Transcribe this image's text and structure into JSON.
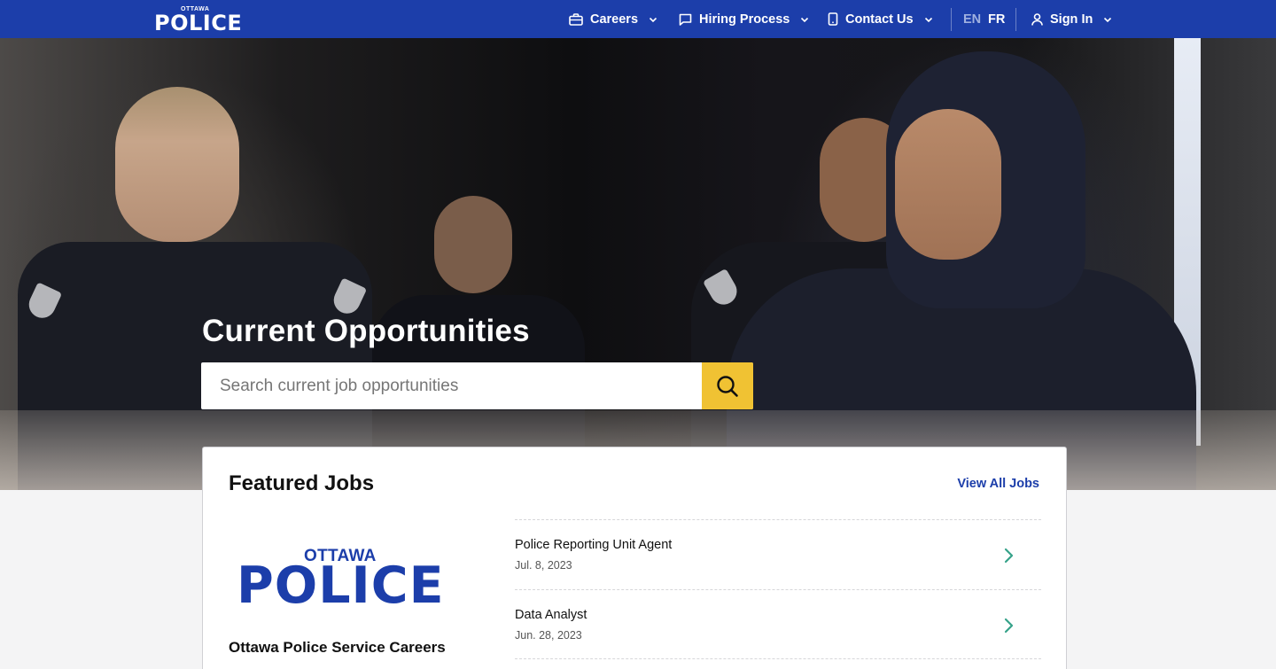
{
  "nav": {
    "logo_small": "OTTAWA",
    "logo_big": "POLICE",
    "items": [
      {
        "label": "Careers",
        "icon": "briefcase-icon"
      },
      {
        "label": "Hiring Process",
        "icon": "chat-bubble-icon"
      },
      {
        "label": "Contact Us",
        "icon": "phone-icon"
      }
    ],
    "lang_en": "EN",
    "lang_fr": "FR",
    "sign_in": "Sign In",
    "colors": {
      "nav_bg": "#1c3eaa",
      "accent": "#f0c233",
      "arrow": "#36a28a"
    }
  },
  "hero": {
    "title": "Current Opportunities",
    "search_placeholder": "Search current job opportunities",
    "search_value": ""
  },
  "featured": {
    "title": "Featured Jobs",
    "view_all": "View All Jobs",
    "org_logo_small": "OTTAWA",
    "org_logo_big": "POLICE",
    "org_name": "Ottawa Police Service Careers",
    "jobs": [
      {
        "title": "Police Reporting Unit Agent",
        "date": "Jul. 8, 2023"
      },
      {
        "title": "Data Analyst",
        "date": "Jun. 28, 2023"
      }
    ]
  }
}
